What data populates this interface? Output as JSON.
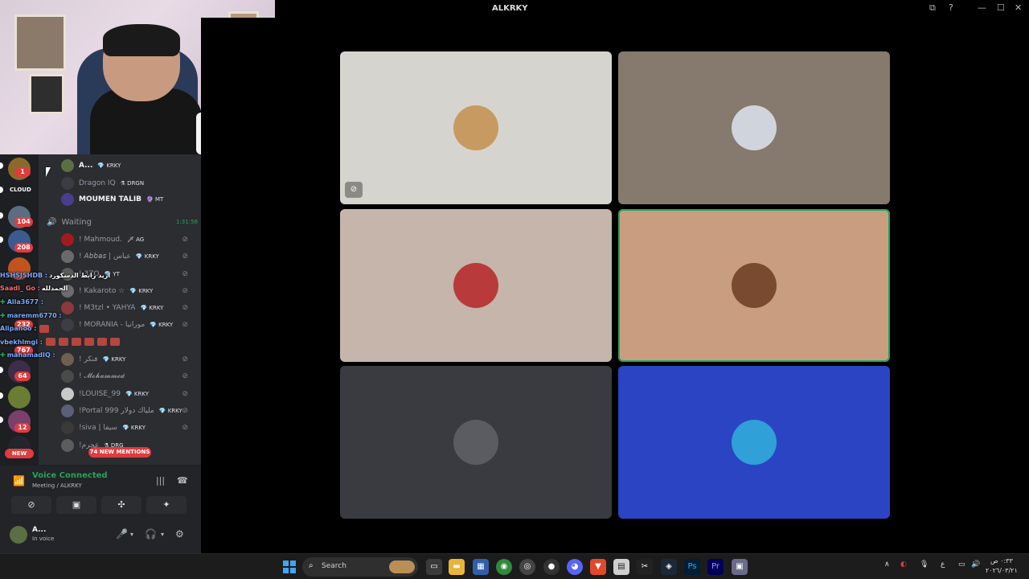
{
  "window": {
    "title": "ALKRKY",
    "controls": [
      "pip-icon",
      "help-icon",
      "minimize-icon",
      "maximize-icon",
      "close-icon"
    ]
  },
  "rail": {
    "cloud_label": "CLOUD",
    "badges": [
      "1",
      "104",
      "208",
      "232",
      "767",
      "64",
      "12"
    ],
    "new_label": "NEW"
  },
  "voice_channel": {
    "name": "Waiting",
    "timer": "1:31:58"
  },
  "members_top": [
    {
      "name": "A...",
      "tag": "💎 KRKY"
    },
    {
      "name": "Dragon IQ",
      "tag": "⚗ DRGN"
    },
    {
      "name": "MOUMEN TALIB",
      "tag": "🔮 MT"
    }
  ],
  "members": [
    {
      "name": "! Mahmoud.",
      "tag": "🗡 AG"
    },
    {
      "name": "! 𝘈𝘣𝘣𝘢𝘴 | عباس",
      "tag": "💎 KRKY"
    },
    {
      "name": "! 3ZO",
      "tag": "💎 YT"
    },
    {
      "name": "! Kakaroto ☆",
      "tag": "💎 KRKY"
    },
    {
      "name": "! M3tzl • YAHYA",
      "tag": "💎 KRKY"
    },
    {
      "name": "! MORANIA - مورانيا",
      "tag": "💎 KRKY"
    },
    {
      "name": "! فنكر",
      "tag": "💎 KRKY"
    },
    {
      "name": "! 𝓜𝓸𝓱𝓪𝓶𝓶𝓮𝓭",
      "tag": ""
    },
    {
      "name": "!LOUISE_99",
      "tag": "💎 KRKY"
    },
    {
      "name": "!Portal 999 ملياك دولار",
      "tag": "💎 KRKY"
    },
    {
      "name": "!siva | سيفا",
      "tag": "💎 KRKY"
    },
    {
      "name": "!عجرم",
      "tag": "⚗ DRG"
    }
  ],
  "chat": [
    {
      "user": "HSHSJSHDB :",
      "msg": "اريد رابط الدسكورد",
      "plus": false,
      "emotes": 0
    },
    {
      "user": "Saadi_ Go :",
      "msg": "الحمدلله",
      "plus": false,
      "emotes": 0
    },
    {
      "user": "Alla3677 :",
      "msg": "",
      "plus": true,
      "emotes": 0
    },
    {
      "user": "maremm6770 :",
      "msg": "",
      "plus": true,
      "emotes": 0
    },
    {
      "user": "Alipanoo :",
      "msg": "",
      "plus": false,
      "emotes": 1
    },
    {
      "user": "vbekhlmgi :",
      "msg": "",
      "plus": false,
      "emotes": 6
    },
    {
      "user": "mahamadIQ :",
      "msg": "",
      "plus": true,
      "emotes": 0
    }
  ],
  "mentions_label": "74 NEW MENTIONS",
  "voice_panel": {
    "status": "Voice Connected",
    "location": "Meeting / ALKRKY"
  },
  "user": {
    "name": "A...",
    "status": "In voice"
  },
  "tiles": [
    {
      "bg": "#d6d4ce",
      "avatar": "#c79a62",
      "active": false,
      "muted": true
    },
    {
      "bg": "#857a6d",
      "avatar": "#d0d4dc",
      "active": false,
      "muted": false
    },
    {
      "bg": "#c5b5aa",
      "avatar": "#b83a3a",
      "active": false,
      "muted": false
    },
    {
      "bg": "#c99d80",
      "avatar": "#7a4a30",
      "active": true,
      "muted": false
    },
    {
      "bg": "#393b41",
      "avatar": "#5a5c62",
      "active": false,
      "muted": false
    },
    {
      "bg": "#2a44c4",
      "avatar": "#2fa0d8",
      "active": false,
      "muted": false
    }
  ],
  "taskbar": {
    "search_label": "Search",
    "clock_time": "٠:٣٣ ص",
    "clock_date": "٢٠٢٦/٠٣/٢١",
    "lang": "ع"
  },
  "colors": {
    "accent_green": "#23a55a",
    "badge_red": "#e03c3f",
    "sidebar": "#2b2d31",
    "rail": "#1e1f22"
  }
}
